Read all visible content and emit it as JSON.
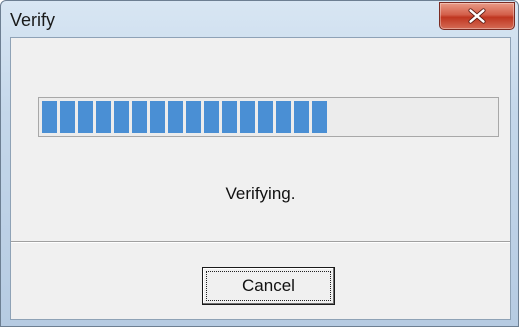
{
  "window": {
    "title": "Verify"
  },
  "progress": {
    "value_fraction": 0.66,
    "block_color": "#4a8fd4",
    "track_color": "#ececec"
  },
  "status": {
    "text": "Verifying."
  },
  "buttons": {
    "cancel_label": "Cancel"
  },
  "icons": {
    "close": "close-icon"
  }
}
